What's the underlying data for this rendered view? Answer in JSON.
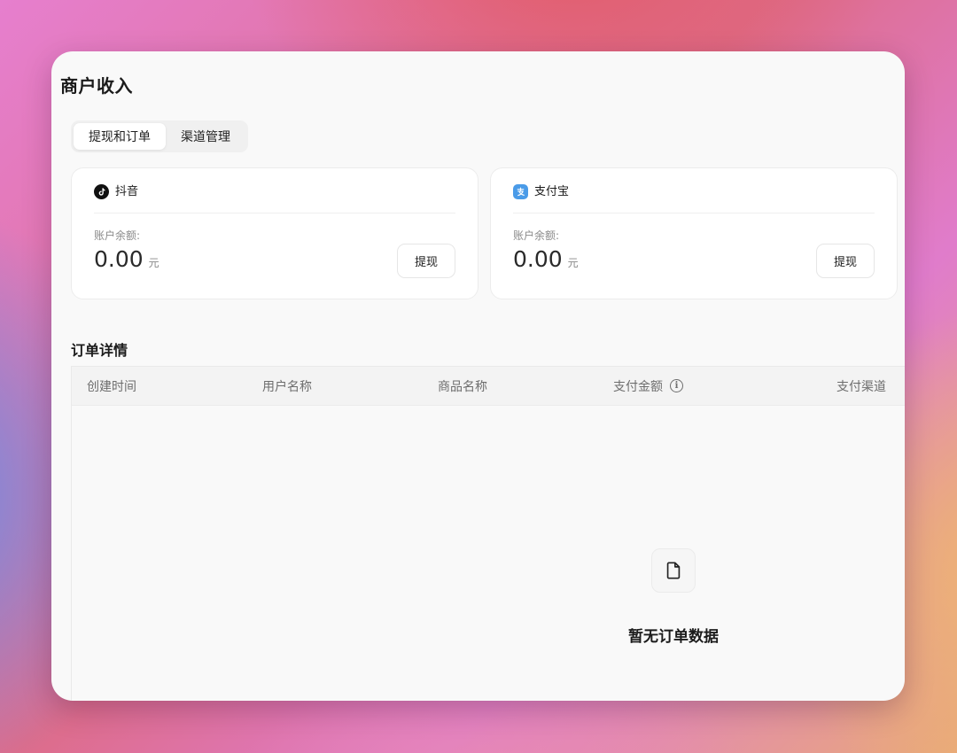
{
  "page": {
    "title": "商户收入"
  },
  "tabs": [
    {
      "label": "提现和订单",
      "active": true
    },
    {
      "label": "渠道管理",
      "active": false
    }
  ],
  "channels": [
    {
      "name": "抖音",
      "icon": "douyin-icon",
      "balance_label": "账户余额:",
      "balance": "0.00",
      "unit": "元",
      "withdraw_label": "提现"
    },
    {
      "name": "支付宝",
      "icon": "alipay-icon",
      "balance_label": "账户余额:",
      "balance": "0.00",
      "unit": "元",
      "withdraw_label": "提现"
    }
  ],
  "orders": {
    "title": "订单详情",
    "columns": [
      "创建时间",
      "用户名称",
      "商品名称",
      "支付金额",
      "支付渠道"
    ],
    "rows": [],
    "empty_text": "暂无订单数据",
    "empty_icon": "document-icon"
  },
  "colors": {
    "window_bg": "#f9f9f9",
    "card_bg": "#ffffff",
    "douyin_icon_bg": "#111111",
    "alipay_icon_bg": "#4a9be8"
  }
}
